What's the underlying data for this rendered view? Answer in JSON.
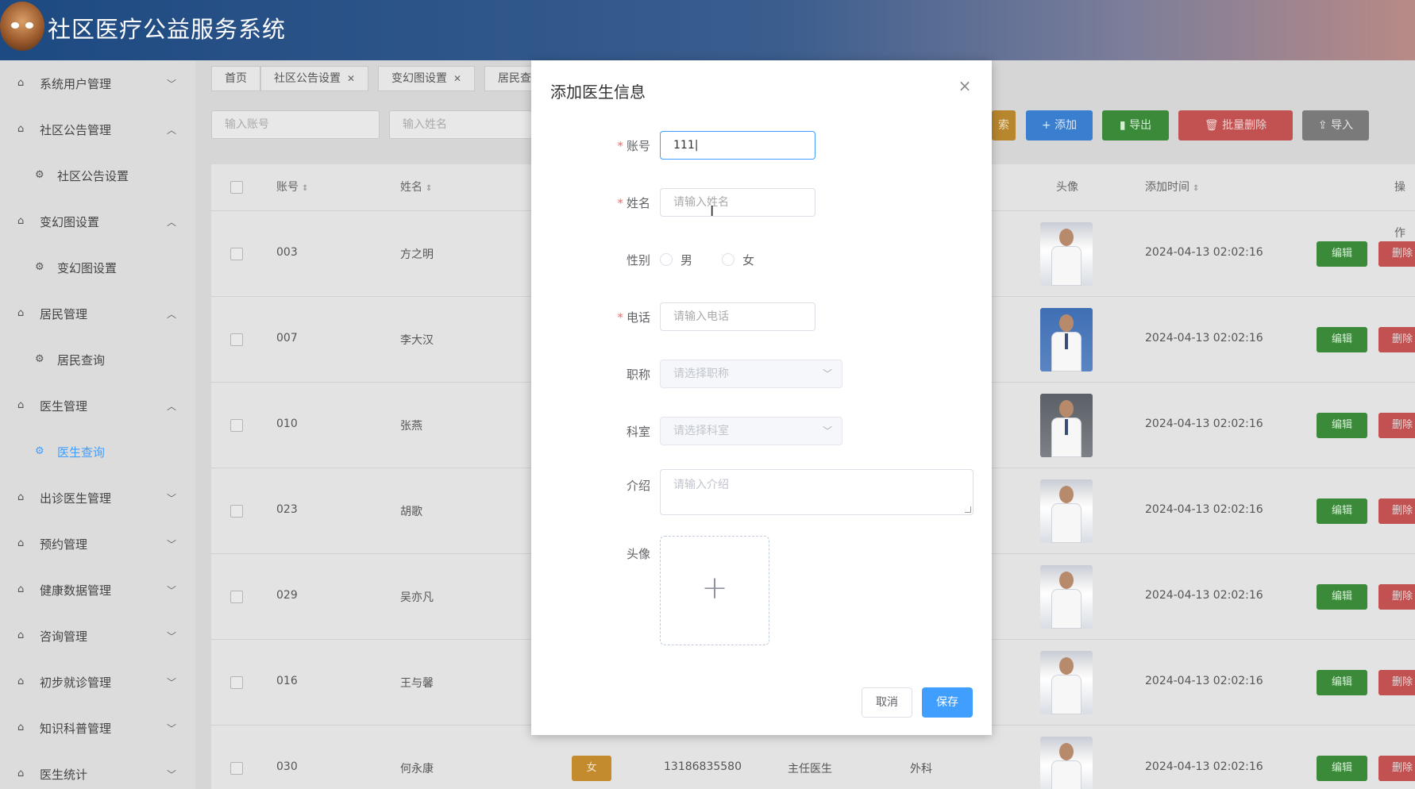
{
  "app": {
    "title": "社区医疗公益服务系统"
  },
  "sidebar": {
    "items": [
      {
        "label": "系统用户管理",
        "arrow": "﹀",
        "icon": "home-icon"
      },
      {
        "label": "社区公告管理",
        "arrow": "︿",
        "icon": "home-icon"
      },
      {
        "label": "社区公告设置",
        "icon": "gear-icon"
      },
      {
        "label": "变幻图设置",
        "arrow": "︿",
        "icon": "home-icon"
      },
      {
        "label": "变幻图设置",
        "icon": "gear-icon"
      },
      {
        "label": "居民管理",
        "arrow": "︿",
        "icon": "home-icon"
      },
      {
        "label": "居民查询",
        "icon": "gear-icon"
      },
      {
        "label": "医生管理",
        "arrow": "︿",
        "icon": "home-icon"
      },
      {
        "label": "医生查询",
        "icon": "gear-icon",
        "active": true
      },
      {
        "label": "出诊医生管理",
        "arrow": "﹀",
        "icon": "home-icon"
      },
      {
        "label": "预约管理",
        "arrow": "﹀",
        "icon": "home-icon"
      },
      {
        "label": "健康数据管理",
        "arrow": "﹀",
        "icon": "home-icon"
      },
      {
        "label": "咨询管理",
        "arrow": "﹀",
        "icon": "home-icon"
      },
      {
        "label": "初步就诊管理",
        "arrow": "﹀",
        "icon": "home-icon"
      },
      {
        "label": "知识科普管理",
        "arrow": "﹀",
        "icon": "home-icon"
      },
      {
        "label": "医生统计",
        "arrow": "﹀",
        "icon": "home-icon"
      }
    ]
  },
  "tabs": [
    {
      "label": "首页"
    },
    {
      "label": "社区公告设置",
      "close": "✕"
    },
    {
      "label": "变幻图设置",
      "close": "✕"
    },
    {
      "label": "居民查"
    }
  ],
  "search": {
    "account_placeholder": "输入账号",
    "name_placeholder": "输入姓名"
  },
  "toolbar": {
    "search_label": "索",
    "add_label": "+ 添加",
    "export_label": "导出",
    "batch_delete_label": "批量删除",
    "import_label": "导入"
  },
  "table": {
    "headers": {
      "account": "账号",
      "name": "姓名",
      "avatar": "头像",
      "added_time": "添加时间",
      "actions": "操作"
    },
    "sort_icon": "⇕",
    "edit_label": "编辑",
    "delete_label": "删除",
    "rows": [
      {
        "account": "003",
        "name": "方之明",
        "time": "2024-04-13 02:02:16"
      },
      {
        "account": "007",
        "name": "李大汉",
        "time": "2024-04-13 02:02:16"
      },
      {
        "account": "010",
        "name": "张燕",
        "time": "2024-04-13 02:02:16"
      },
      {
        "account": "023",
        "name": "胡歌",
        "time": "2024-04-13 02:02:16"
      },
      {
        "account": "029",
        "name": "吴亦凡",
        "time": "2024-04-13 02:02:16"
      },
      {
        "account": "016",
        "name": "王与馨",
        "time": "2024-04-13 02:02:16"
      },
      {
        "account": "030",
        "name": "何永康",
        "gender": "女",
        "phone": "13186835580",
        "title": "主任医生",
        "dept": "外科",
        "time": "2024-04-13 02:02:16"
      }
    ]
  },
  "dialog": {
    "title": "添加医生信息",
    "close_icon": "×",
    "fields": {
      "account": {
        "label": "账号",
        "required": "*",
        "value": "111|"
      },
      "name": {
        "label": "姓名",
        "required": "*",
        "placeholder": "请输入姓名"
      },
      "gender": {
        "label": "性别",
        "options": [
          "男",
          "女"
        ]
      },
      "phone": {
        "label": "电话",
        "required": "*",
        "placeholder": "请输入电话"
      },
      "title": {
        "label": "职称",
        "placeholder": "请选择职称"
      },
      "dept": {
        "label": "科室",
        "placeholder": "请选择科室"
      },
      "intro": {
        "label": "介绍",
        "placeholder": "请输入介绍"
      },
      "avatar": {
        "label": "头像",
        "plus": "+"
      }
    },
    "cancel_label": "取消",
    "save_label": "保存"
  },
  "colors": {
    "primary": "#409eff",
    "success": "#67c23a",
    "danger": "#f56c6c",
    "warning": "#e6a23c",
    "info": "#909399"
  }
}
